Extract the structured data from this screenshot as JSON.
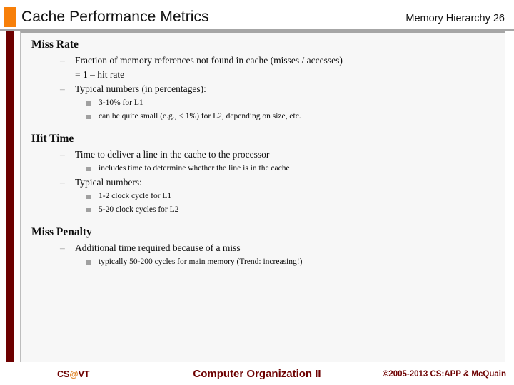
{
  "header": {
    "title": "Cache Performance Metrics",
    "right_label": "Memory Hierarchy 26",
    "marker_color": "#f77f09",
    "rule_color": "#a6a6a6"
  },
  "accent": {
    "left_bar_color": "#6d0000",
    "panel_background": "#f7f7f7"
  },
  "content": {
    "sections": [
      {
        "heading": "Miss Rate",
        "bullets": [
          {
            "text": "Fraction of memory references not found in cache (misses / accesses) = 1 – hit rate",
            "line1": "Fraction of memory references not found in cache (misses / accesses)",
            "line2": "= 1 – hit rate",
            "marker": "dash",
            "children": []
          },
          {
            "text": "Typical numbers (in percentages):",
            "marker": "dash",
            "children": [
              {
                "text": "3-10% for L1",
                "marker": "square"
              },
              {
                "text": "can be quite small (e.g., < 1%) for L2, depending on size, etc.",
                "marker": "square"
              }
            ]
          }
        ]
      },
      {
        "heading": "Hit Time",
        "bullets": [
          {
            "text": "Time to deliver a line in the cache to the processor",
            "marker": "dash",
            "children": [
              {
                "text": "includes time to determine whether the line is in the cache",
                "marker": "square"
              }
            ]
          },
          {
            "text": "Typical numbers:",
            "marker": "dash",
            "children": [
              {
                "text": "1-2 clock cycle for L1",
                "marker": "square"
              },
              {
                "text": "5-20 clock cycles for L2",
                "marker": "square"
              }
            ]
          }
        ]
      },
      {
        "heading": "Miss Penalty",
        "bullets": [
          {
            "text": "Additional time required because of a miss",
            "marker": "dash",
            "children": [
              {
                "text": "typically 50-200 cycles for main memory (Trend: increasing!)",
                "marker": "square"
              }
            ]
          }
        ]
      }
    ],
    "dash_glyph": "–",
    "square_glyph": "▪"
  },
  "footer": {
    "left_prefix": "CS",
    "left_at": "@",
    "left_suffix": "VT",
    "center": "Computer Organization II",
    "right": "©2005-2013 CS:APP & McQuain",
    "text_color": "#6d0000",
    "at_color": "#e08020"
  }
}
